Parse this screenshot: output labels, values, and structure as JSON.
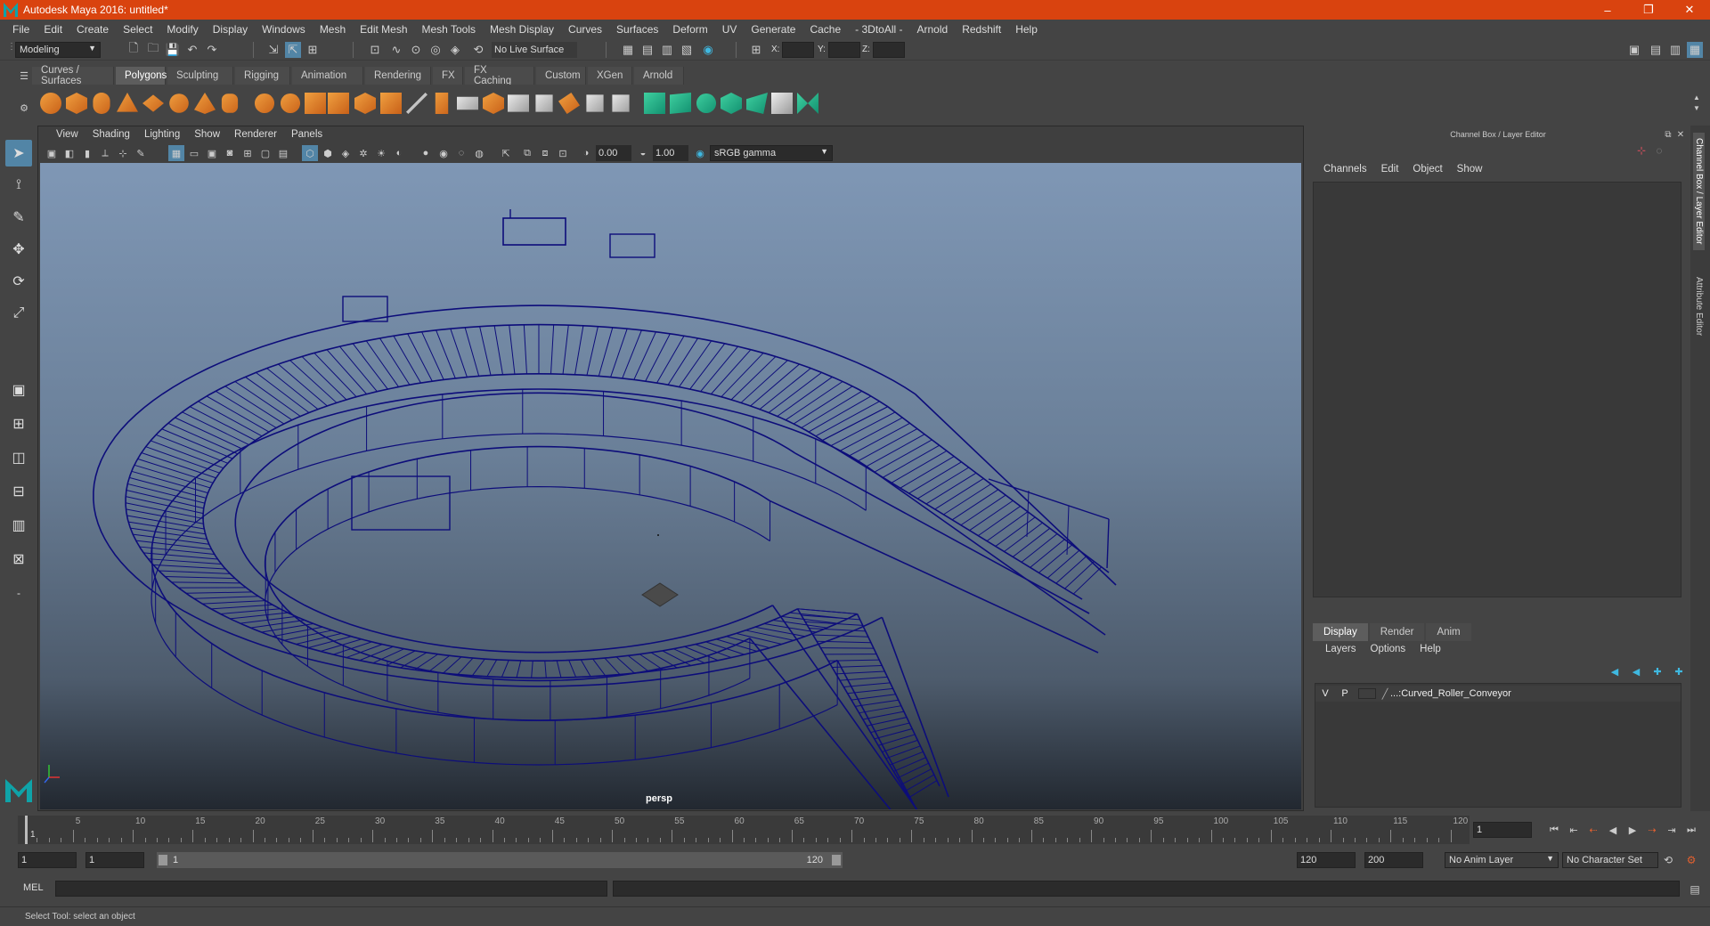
{
  "window": {
    "title": "Autodesk Maya 2016: untitled*",
    "minimize": "–",
    "maximize": "❐",
    "close": "✕"
  },
  "menubar": [
    "File",
    "Edit",
    "Create",
    "Select",
    "Modify",
    "Display",
    "Windows",
    "Mesh",
    "Edit Mesh",
    "Mesh Tools",
    "Mesh Display",
    "Curves",
    "Surfaces",
    "Deform",
    "UV",
    "Generate",
    "Cache",
    "- 3DtoAll -",
    "Arnold",
    "Redshift",
    "Help"
  ],
  "statusline": {
    "mode": "Modeling",
    "live_surface": "No Live Surface",
    "x_label": "X:",
    "y_label": "Y:",
    "z_label": "Z:"
  },
  "shelf_tabs": [
    "Curves / Surfaces",
    "Polygons",
    "Sculpting",
    "Rigging",
    "Animation",
    "Rendering",
    "FX",
    "FX Caching",
    "Custom",
    "XGen",
    "Arnold"
  ],
  "shelf_active": "Polygons",
  "viewport": {
    "menu": [
      "View",
      "Shading",
      "Lighting",
      "Show",
      "Renderer",
      "Panels"
    ],
    "exposure": "0.00",
    "gamma": "1.00",
    "color_space": "sRGB gamma",
    "camera": "persp",
    "wire_color": "#0d0d7a"
  },
  "channel_box": {
    "title": "Channel Box / Layer Editor",
    "menu": [
      "Channels",
      "Edit",
      "Object",
      "Show"
    ]
  },
  "layer_editor": {
    "tabs": [
      "Display",
      "Render",
      "Anim"
    ],
    "active_tab": "Display",
    "menu": [
      "Layers",
      "Options",
      "Help"
    ],
    "layer": {
      "v": "V",
      "p": "P",
      "name": "...:Curved_Roller_Conveyor"
    }
  },
  "side_tabs": [
    "Channel Box / Layer Editor",
    "Attribute Editor"
  ],
  "timeline": {
    "labels": [
      "5",
      "10",
      "15",
      "20",
      "25",
      "30",
      "35",
      "40",
      "45",
      "50",
      "55",
      "60",
      "65",
      "70",
      "75",
      "80",
      "85",
      "90",
      "95",
      "100",
      "105",
      "110",
      "115",
      "120"
    ],
    "current_frame_marker": "1",
    "current_frame": "1"
  },
  "range": {
    "start": "1",
    "inner_start": "1",
    "slider_start": "1",
    "slider_end": "120",
    "end": "120",
    "max": "200",
    "anim_layer": "No Anim Layer",
    "char_set": "No Character Set"
  },
  "cmdline": {
    "label": "MEL"
  },
  "helpline": "Select Tool: select an object",
  "colors": {
    "title_bar": "#d9430f",
    "accent": "#5285a6",
    "bg": "#444444"
  }
}
